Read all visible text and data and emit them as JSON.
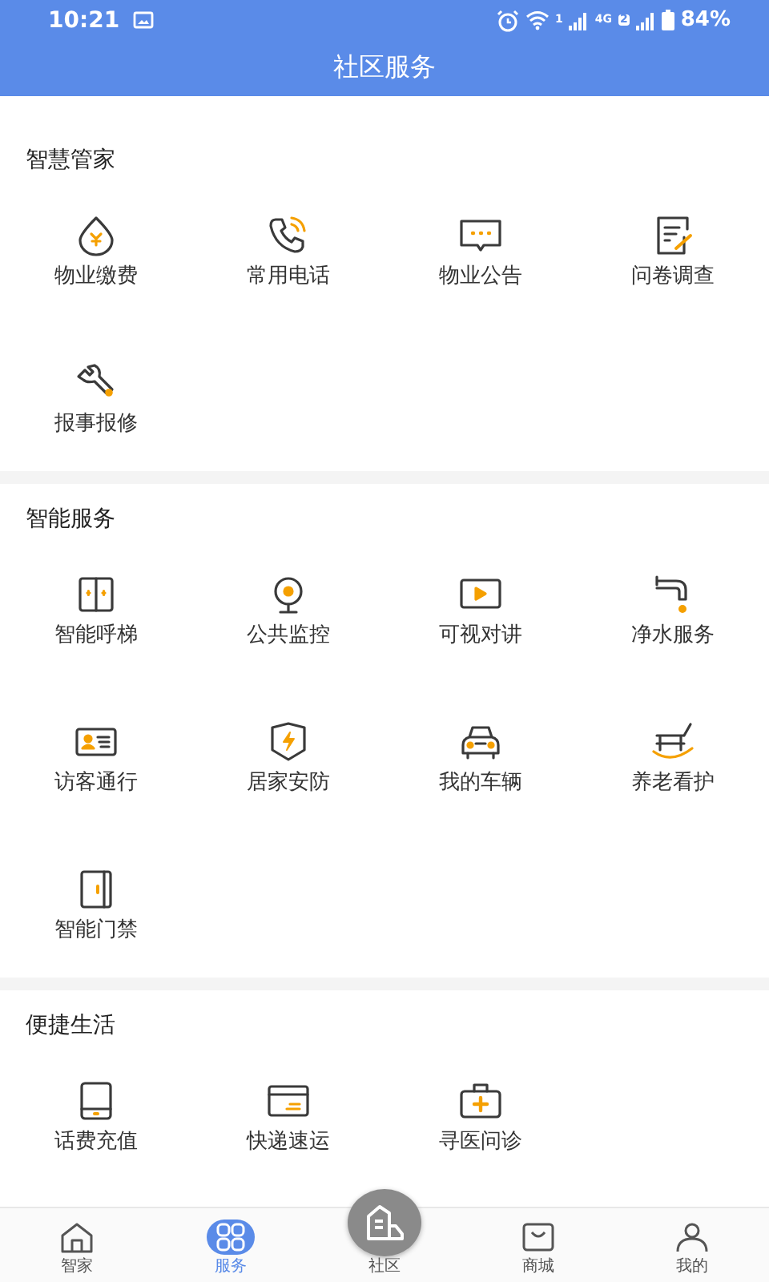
{
  "status_bar": {
    "time": "10:21",
    "sim_1": "1",
    "network": "4G",
    "sim_2": "2",
    "battery": "84%"
  },
  "header": {
    "title": "社区服务"
  },
  "sections": [
    {
      "title": "智慧管家",
      "items": [
        {
          "label": "物业缴费"
        },
        {
          "label": "常用电话"
        },
        {
          "label": "物业公告"
        },
        {
          "label": "问卷调查"
        },
        {
          "label": "报事报修"
        }
      ]
    },
    {
      "title": "智能服务",
      "items": [
        {
          "label": "智能呼梯"
        },
        {
          "label": "公共监控"
        },
        {
          "label": "可视对讲"
        },
        {
          "label": "净水服务"
        },
        {
          "label": "访客通行"
        },
        {
          "label": "居家安防"
        },
        {
          "label": "我的车辆"
        },
        {
          "label": "养老看护"
        },
        {
          "label": "智能门禁"
        }
      ]
    },
    {
      "title": "便捷生活",
      "items": [
        {
          "label": "话费充值"
        },
        {
          "label": "快递速运"
        },
        {
          "label": "寻医问诊"
        }
      ]
    }
  ],
  "tab_bar": [
    {
      "label": "智家",
      "selected": false
    },
    {
      "label": "服务",
      "selected": true
    },
    {
      "label": "社区",
      "selected": false
    },
    {
      "label": "商城",
      "selected": false
    },
    {
      "label": "我的",
      "selected": false
    }
  ]
}
